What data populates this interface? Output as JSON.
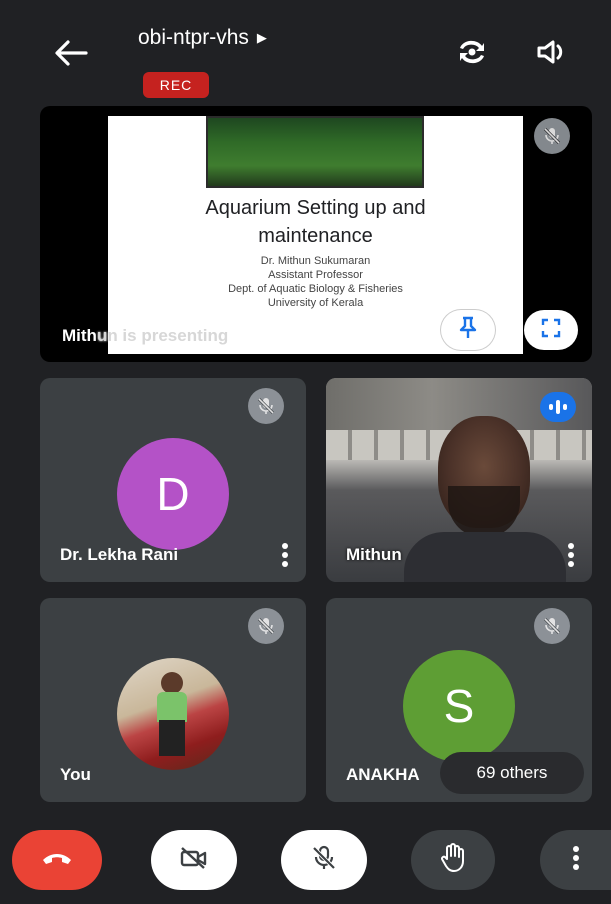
{
  "header": {
    "meeting_code": "obi-ntpr-vhs",
    "title_arrow": "▶",
    "rec_badge": "REC",
    "back_icon": "arrow-left",
    "switch_camera_icon": "switch-camera",
    "speaker_icon": "volume"
  },
  "presentation": {
    "slide_title_line1": "Aquarium Setting up and",
    "slide_title_line2": "maintenance",
    "author": "Dr. Mithun Sukumaran",
    "position": "Assistant Professor",
    "department": "Dept. of Aquatic Biology & Fisheries",
    "university": "University of Kerala",
    "presenting_label_a": "Mith",
    "presenting_label_b": "un is presenting"
  },
  "participants": [
    {
      "name": "Dr. Lekha Rani",
      "initial": "D",
      "avatar_color": "#b452c7",
      "muted": true
    },
    {
      "name": "Mithun",
      "speaking": true
    },
    {
      "name": "You",
      "muted": true
    },
    {
      "name": "ANAKHA",
      "initial": "S",
      "avatar_color": "#5e9e34",
      "muted": true,
      "others_label": "69 others"
    }
  ],
  "controls": {
    "end_call_color": "#ea4335",
    "items": [
      "end-call",
      "camera-off",
      "mic-off",
      "raise-hand",
      "more"
    ]
  }
}
